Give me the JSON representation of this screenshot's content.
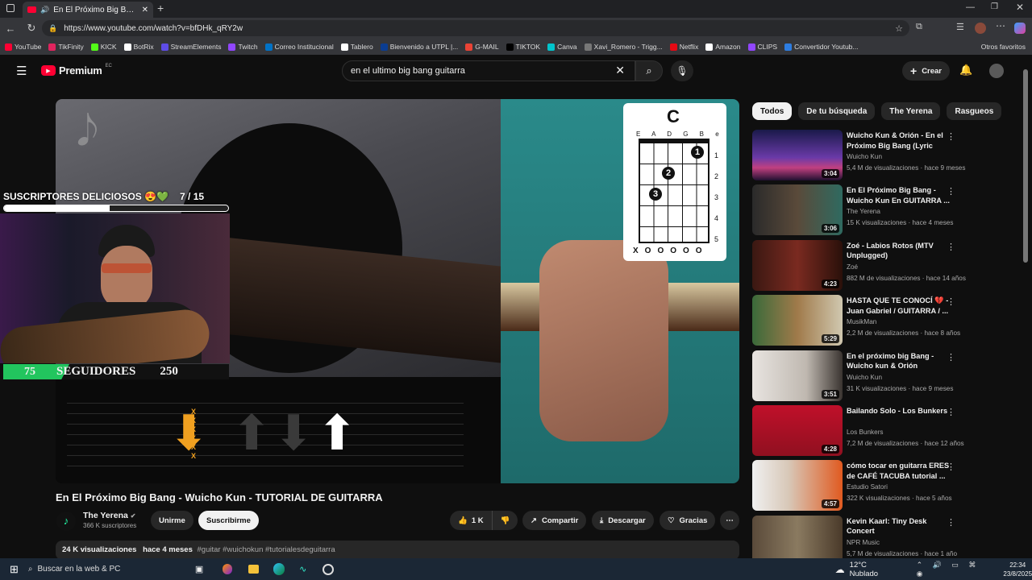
{
  "browser": {
    "tab_title": "En El Próximo Big Bang - Wuic",
    "url": "https://www.youtube.com/watch?v=bfDHk_qRY2w",
    "bookmarks": [
      {
        "label": "YouTube",
        "color": "#ff0033"
      },
      {
        "label": "TikFinity",
        "color": "#e0245e"
      },
      {
        "label": "KICK",
        "color": "#53fc18"
      },
      {
        "label": "BotRix",
        "color": "#ffffff"
      },
      {
        "label": "StreamElements",
        "color": "#5e4ce6"
      },
      {
        "label": "Twitch",
        "color": "#9146ff"
      },
      {
        "label": "Correo Institucional",
        "color": "#0072c6"
      },
      {
        "label": "Tablero",
        "color": "#ffffff"
      },
      {
        "label": "Bienvenido a UTPL |...",
        "color": "#0b3d91"
      },
      {
        "label": "G-MAIL",
        "color": "#ea4335"
      },
      {
        "label": "TIKTOK",
        "color": "#000000"
      },
      {
        "label": "Canva",
        "color": "#00c4cc"
      },
      {
        "label": "Xavi_Romero - Trigg...",
        "color": "#777777"
      },
      {
        "label": "Netflix",
        "color": "#e50914"
      },
      {
        "label": "Amazon",
        "color": "#ffffff"
      },
      {
        "label": "CLIPS",
        "color": "#9146ff"
      },
      {
        "label": "Convertidor Youtub...",
        "color": "#2d7de1"
      }
    ],
    "other_favorites": "Otros favoritos"
  },
  "youtube": {
    "logo": "Premium",
    "region": "EC",
    "search_query": "en el ultimo big bang guitarra",
    "create_label": "Crear"
  },
  "overlay": {
    "subs_label": "SUSCRIPTORES DELICIOSOS 😍💚",
    "subs_count": "7  / 15",
    "subs_progress": 0.47,
    "followers_label": "SEGUIDORES",
    "followers_current": "75",
    "followers_goal": "250",
    "chord_name": "C",
    "chord_strings": "E A D G B e",
    "fret_numbers": [
      "1",
      "2",
      "3",
      "4",
      "5"
    ],
    "finger_1": "1",
    "finger_2": "2",
    "finger_3": "3",
    "string_marks": [
      "X",
      "O",
      "O",
      "O",
      "O",
      "O"
    ]
  },
  "video": {
    "title": "En El Próximo Big Bang - Wuicho Kun - TUTORIAL DE GUITARRA",
    "channel": "The Yerena",
    "subscribers": "366 K suscriptores",
    "join_label": "Unirme",
    "subscribe_label": "Suscribirme",
    "likes": "1 K",
    "share_label": "Compartir",
    "download_label": "Descargar",
    "thanks_label": "Gracias",
    "views": "24 K visualizaciones",
    "age": "hace 4 meses",
    "hashtags": "#guitar #wuichokun #tutorialesdeguitarra"
  },
  "chips": [
    "Todos",
    "De tu búsqueda",
    "The Yerena",
    "Rasgueos"
  ],
  "recommendations": [
    {
      "title": "Wuicho Kun & Orión - En el Próximo Big Bang (Lyric Video)",
      "channel": "Wuicho Kun",
      "meta": "5,4 M de visualizaciones · hace 9 meses",
      "duration": "3:04",
      "bg": "linear-gradient(180deg,#1a1a4a,#6a3aa8 55%,#c04080 75%,#201030)"
    },
    {
      "title": "En El Próximo Big Bang - Wuicho Kun En GUITARRA ...",
      "channel": "The Yerena",
      "meta": "15 K visualizaciones · hace 4 meses",
      "duration": "3:06",
      "bg": "linear-gradient(90deg,#2a2a2a,#5a4a3a 50%,#2f6a60)"
    },
    {
      "title": "Zoé - Labios Rotos (MTV Unplugged)",
      "channel": "Zoé",
      "meta": "882 M de visualizaciones · hace 14 años",
      "duration": "4:23",
      "bg": "linear-gradient(90deg,#3a1812,#7a2a20 50%,#2a100a)"
    },
    {
      "title": "HASTA QUE TE CONOCÍ 💔 - Juan Gabriel / GUITARRA / ...",
      "channel": "MusikMan",
      "meta": "2,2 M de visualizaciones · hace 8 años",
      "duration": "5:29",
      "bg": "linear-gradient(90deg,#3a6a3a,#a07a4a 50%,#d0c8b0)"
    },
    {
      "title": "En el próximo big Bang - Wuicho kun & Orión [TUTORIAL]",
      "channel": "Wuicho Kun",
      "meta": "31 K visualizaciones · hace 9 meses",
      "duration": "3:51",
      "bg": "linear-gradient(90deg,#e8e4e0,#bfb8b0 60%,#3a3430)"
    },
    {
      "title": "Bailando Solo - Los Bunkers",
      "channel": "Los Bunkers",
      "meta": "7,2 M de visualizaciones · hace 12 años",
      "duration": "4:28",
      "bg": "linear-gradient(180deg,#c0102a,#901020)"
    },
    {
      "title": "cómo tocar en guitarra ERES de CAFÉ TACUBA tutorial ...",
      "channel": "Estudio Satori",
      "meta": "322 K visualizaciones · hace 5 años",
      "duration": "4:57",
      "bg": "linear-gradient(90deg,#f0f0f0,#d8c8b8 40%,#e05a20)"
    },
    {
      "title": "Kevin Kaarl: Tiny Desk Concert",
      "channel": "NPR Music",
      "meta": "5,7 M de visualizaciones · hace 1 año",
      "duration": "",
      "bg": "linear-gradient(90deg,#5a4a3a,#8a7a60 50%,#4a3a2a)"
    }
  ],
  "taskbar": {
    "search_placeholder": "Buscar en la web & PC",
    "weather": "12°C  Nublado",
    "time": "22:34",
    "date": "23/8/2025"
  }
}
